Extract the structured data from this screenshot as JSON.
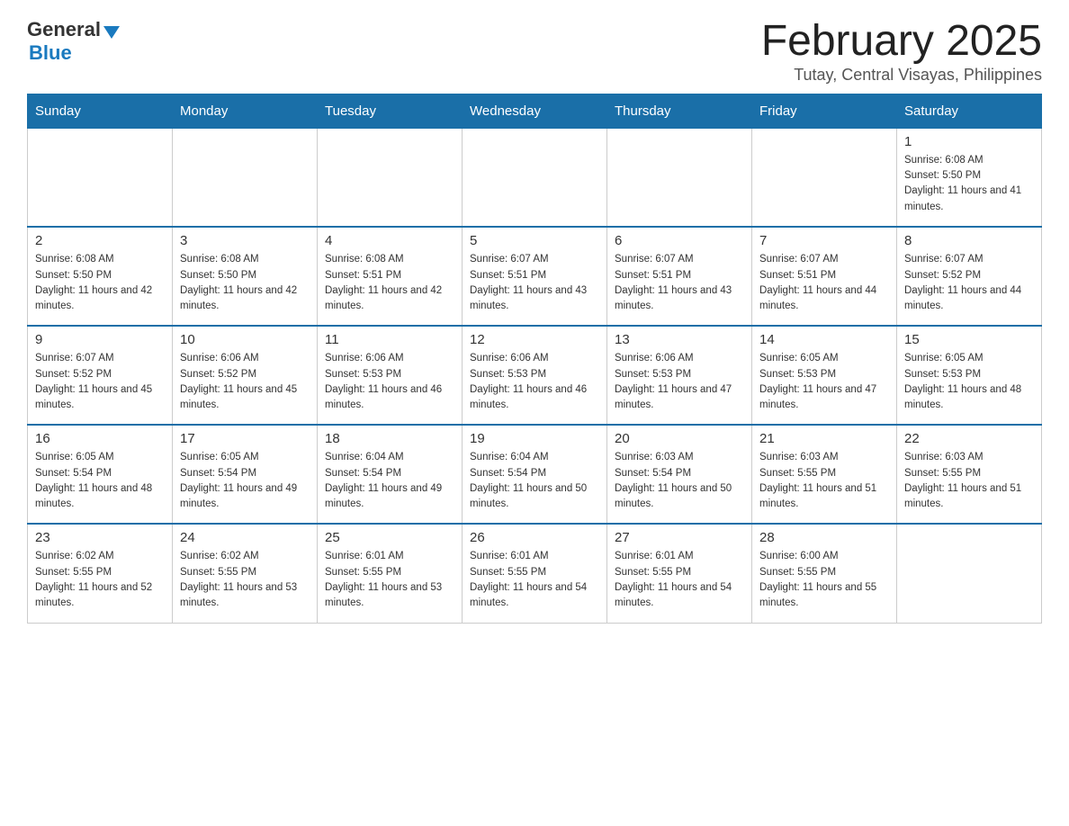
{
  "header": {
    "logo_general": "General",
    "logo_blue": "Blue",
    "month_title": "February 2025",
    "location": "Tutay, Central Visayas, Philippines"
  },
  "days_of_week": [
    "Sunday",
    "Monday",
    "Tuesday",
    "Wednesday",
    "Thursday",
    "Friday",
    "Saturday"
  ],
  "weeks": [
    [
      {
        "day": "",
        "sunrise": "",
        "sunset": "",
        "daylight": ""
      },
      {
        "day": "",
        "sunrise": "",
        "sunset": "",
        "daylight": ""
      },
      {
        "day": "",
        "sunrise": "",
        "sunset": "",
        "daylight": ""
      },
      {
        "day": "",
        "sunrise": "",
        "sunset": "",
        "daylight": ""
      },
      {
        "day": "",
        "sunrise": "",
        "sunset": "",
        "daylight": ""
      },
      {
        "day": "",
        "sunrise": "",
        "sunset": "",
        "daylight": ""
      },
      {
        "day": "1",
        "sunrise": "Sunrise: 6:08 AM",
        "sunset": "Sunset: 5:50 PM",
        "daylight": "Daylight: 11 hours and 41 minutes."
      }
    ],
    [
      {
        "day": "2",
        "sunrise": "Sunrise: 6:08 AM",
        "sunset": "Sunset: 5:50 PM",
        "daylight": "Daylight: 11 hours and 42 minutes."
      },
      {
        "day": "3",
        "sunrise": "Sunrise: 6:08 AM",
        "sunset": "Sunset: 5:50 PM",
        "daylight": "Daylight: 11 hours and 42 minutes."
      },
      {
        "day": "4",
        "sunrise": "Sunrise: 6:08 AM",
        "sunset": "Sunset: 5:51 PM",
        "daylight": "Daylight: 11 hours and 42 minutes."
      },
      {
        "day": "5",
        "sunrise": "Sunrise: 6:07 AM",
        "sunset": "Sunset: 5:51 PM",
        "daylight": "Daylight: 11 hours and 43 minutes."
      },
      {
        "day": "6",
        "sunrise": "Sunrise: 6:07 AM",
        "sunset": "Sunset: 5:51 PM",
        "daylight": "Daylight: 11 hours and 43 minutes."
      },
      {
        "day": "7",
        "sunrise": "Sunrise: 6:07 AM",
        "sunset": "Sunset: 5:51 PM",
        "daylight": "Daylight: 11 hours and 44 minutes."
      },
      {
        "day": "8",
        "sunrise": "Sunrise: 6:07 AM",
        "sunset": "Sunset: 5:52 PM",
        "daylight": "Daylight: 11 hours and 44 minutes."
      }
    ],
    [
      {
        "day": "9",
        "sunrise": "Sunrise: 6:07 AM",
        "sunset": "Sunset: 5:52 PM",
        "daylight": "Daylight: 11 hours and 45 minutes."
      },
      {
        "day": "10",
        "sunrise": "Sunrise: 6:06 AM",
        "sunset": "Sunset: 5:52 PM",
        "daylight": "Daylight: 11 hours and 45 minutes."
      },
      {
        "day": "11",
        "sunrise": "Sunrise: 6:06 AM",
        "sunset": "Sunset: 5:53 PM",
        "daylight": "Daylight: 11 hours and 46 minutes."
      },
      {
        "day": "12",
        "sunrise": "Sunrise: 6:06 AM",
        "sunset": "Sunset: 5:53 PM",
        "daylight": "Daylight: 11 hours and 46 minutes."
      },
      {
        "day": "13",
        "sunrise": "Sunrise: 6:06 AM",
        "sunset": "Sunset: 5:53 PM",
        "daylight": "Daylight: 11 hours and 47 minutes."
      },
      {
        "day": "14",
        "sunrise": "Sunrise: 6:05 AM",
        "sunset": "Sunset: 5:53 PM",
        "daylight": "Daylight: 11 hours and 47 minutes."
      },
      {
        "day": "15",
        "sunrise": "Sunrise: 6:05 AM",
        "sunset": "Sunset: 5:53 PM",
        "daylight": "Daylight: 11 hours and 48 minutes."
      }
    ],
    [
      {
        "day": "16",
        "sunrise": "Sunrise: 6:05 AM",
        "sunset": "Sunset: 5:54 PM",
        "daylight": "Daylight: 11 hours and 48 minutes."
      },
      {
        "day": "17",
        "sunrise": "Sunrise: 6:05 AM",
        "sunset": "Sunset: 5:54 PM",
        "daylight": "Daylight: 11 hours and 49 minutes."
      },
      {
        "day": "18",
        "sunrise": "Sunrise: 6:04 AM",
        "sunset": "Sunset: 5:54 PM",
        "daylight": "Daylight: 11 hours and 49 minutes."
      },
      {
        "day": "19",
        "sunrise": "Sunrise: 6:04 AM",
        "sunset": "Sunset: 5:54 PM",
        "daylight": "Daylight: 11 hours and 50 minutes."
      },
      {
        "day": "20",
        "sunrise": "Sunrise: 6:03 AM",
        "sunset": "Sunset: 5:54 PM",
        "daylight": "Daylight: 11 hours and 50 minutes."
      },
      {
        "day": "21",
        "sunrise": "Sunrise: 6:03 AM",
        "sunset": "Sunset: 5:55 PM",
        "daylight": "Daylight: 11 hours and 51 minutes."
      },
      {
        "day": "22",
        "sunrise": "Sunrise: 6:03 AM",
        "sunset": "Sunset: 5:55 PM",
        "daylight": "Daylight: 11 hours and 51 minutes."
      }
    ],
    [
      {
        "day": "23",
        "sunrise": "Sunrise: 6:02 AM",
        "sunset": "Sunset: 5:55 PM",
        "daylight": "Daylight: 11 hours and 52 minutes."
      },
      {
        "day": "24",
        "sunrise": "Sunrise: 6:02 AM",
        "sunset": "Sunset: 5:55 PM",
        "daylight": "Daylight: 11 hours and 53 minutes."
      },
      {
        "day": "25",
        "sunrise": "Sunrise: 6:01 AM",
        "sunset": "Sunset: 5:55 PM",
        "daylight": "Daylight: 11 hours and 53 minutes."
      },
      {
        "day": "26",
        "sunrise": "Sunrise: 6:01 AM",
        "sunset": "Sunset: 5:55 PM",
        "daylight": "Daylight: 11 hours and 54 minutes."
      },
      {
        "day": "27",
        "sunrise": "Sunrise: 6:01 AM",
        "sunset": "Sunset: 5:55 PM",
        "daylight": "Daylight: 11 hours and 54 minutes."
      },
      {
        "day": "28",
        "sunrise": "Sunrise: 6:00 AM",
        "sunset": "Sunset: 5:55 PM",
        "daylight": "Daylight: 11 hours and 55 minutes."
      },
      {
        "day": "",
        "sunrise": "",
        "sunset": "",
        "daylight": ""
      }
    ]
  ]
}
